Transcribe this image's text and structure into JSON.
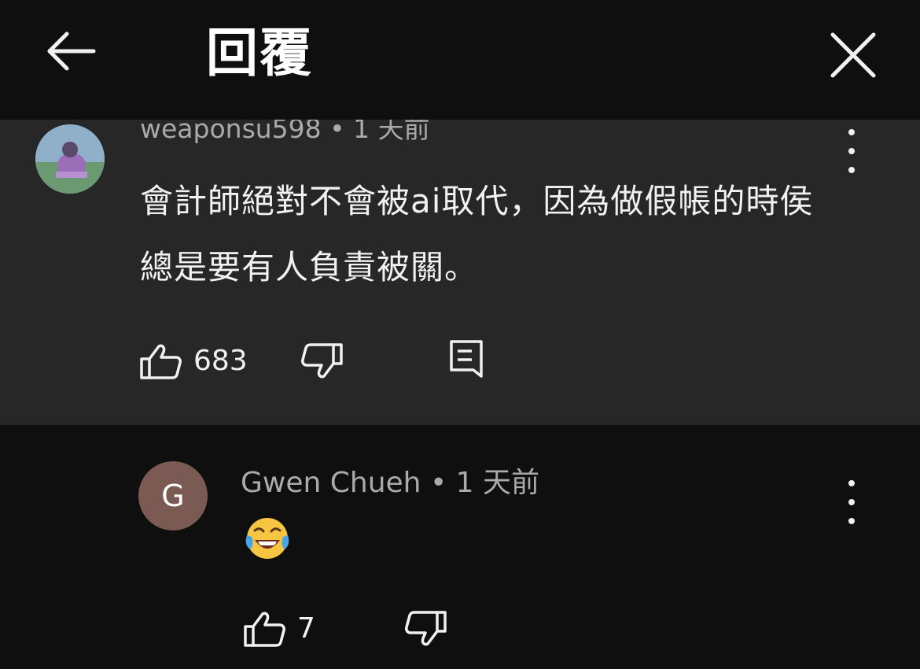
{
  "header": {
    "title": "回覆",
    "back_icon": "arrow-left-icon",
    "close_icon": "close-icon"
  },
  "parent_comment": {
    "author": "weaponsu598",
    "separator": "•",
    "time": "1 天前",
    "text": "會計師絕對不會被ai取代，因為做假帳的時侯總是要有人負責被關。",
    "likes": "683",
    "icons": [
      "avatar",
      "thumbs-up-icon",
      "thumbs-down-icon",
      "reply-icon",
      "more-vertical-icon"
    ]
  },
  "reply": {
    "avatar_letter": "G",
    "author": "Gwen Chueh",
    "separator": "•",
    "time": "1 天前",
    "emoji": "face-with-tears-of-joy-icon",
    "likes": "7"
  },
  "colors": {
    "background": "#0f0f0f",
    "parent_bg": "#272727",
    "text": "#f1f1f1",
    "secondary_text": "#aaaaaa",
    "reply_avatar": "#7a5a52"
  }
}
